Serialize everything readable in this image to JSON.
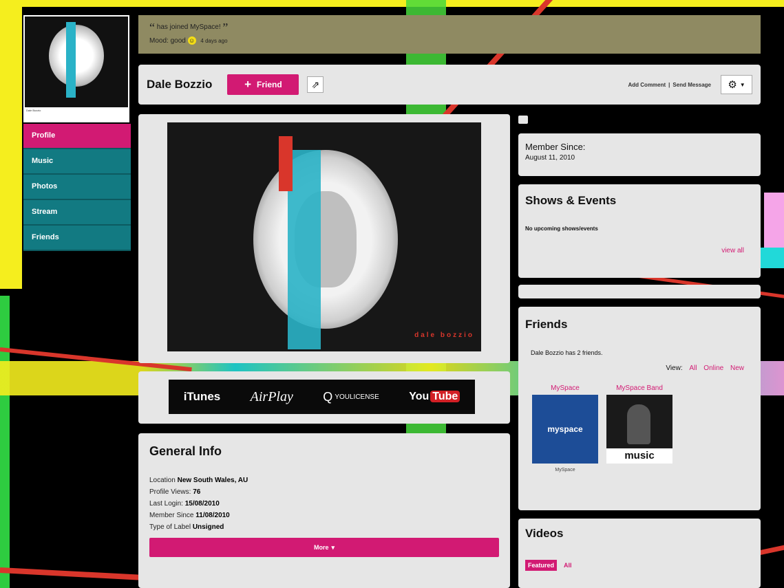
{
  "status": {
    "open_quote": "“",
    "message": "has joined MySpace!",
    "close_quote": "”",
    "mood_label": "Mood: good",
    "mood_icon": "smiley-icon",
    "time_ago": "4 days ago"
  },
  "profile": {
    "name": "Dale Bozzio",
    "friend_button": "Friend",
    "photo_signature": "dale bozzio",
    "avatar_caption": "Dale Bozzio"
  },
  "header_links": {
    "add_comment": "Add Comment",
    "separator": "|",
    "send_message": "Send Message"
  },
  "nav": {
    "items": [
      {
        "label": "Profile"
      },
      {
        "label": "Music"
      },
      {
        "label": "Photos"
      },
      {
        "label": "Stream"
      },
      {
        "label": "Friends"
      }
    ]
  },
  "services": {
    "itunes": "iTunes",
    "airplay": "AirPlay",
    "youlicense": "YOULICENSE",
    "youtube_you": "You",
    "youtube_tube": "Tube"
  },
  "general_info": {
    "title": "General Info",
    "rows": [
      {
        "label": "Location",
        "value": "New South Wales, AU"
      },
      {
        "label": "Profile Views:",
        "value": "76"
      },
      {
        "label": "Last Login:",
        "value": "15/08/2010"
      },
      {
        "label": "Member Since",
        "value": "11/08/2010"
      },
      {
        "label": "Type of Label",
        "value": "Unsigned"
      }
    ],
    "more_button": "More"
  },
  "member_since": {
    "title": "Member Since:",
    "date": "August 11, 2010"
  },
  "shows": {
    "title": "Shows & Events",
    "empty_text": "No upcoming shows/events",
    "view_all": "view all"
  },
  "friends": {
    "title": "Friends",
    "count_text": "Dale Bozzio has 2 friends.",
    "view_label": "View:",
    "view_all": "All",
    "view_online": "Online",
    "view_new": "New",
    "cards": [
      {
        "name": "MySpace",
        "thumb_text": "myspace",
        "caption": "MySpace"
      },
      {
        "name": "MySpace Band",
        "thumb_text": "music",
        "caption": ""
      }
    ]
  },
  "videos": {
    "title": "Videos",
    "tab_featured": "Featured",
    "tab_all": "All"
  },
  "colors": {
    "accent": "#d21a73",
    "nav_teal": "#127a82",
    "status_bar": "#8f8a62",
    "panel": "#e6e6e6"
  }
}
